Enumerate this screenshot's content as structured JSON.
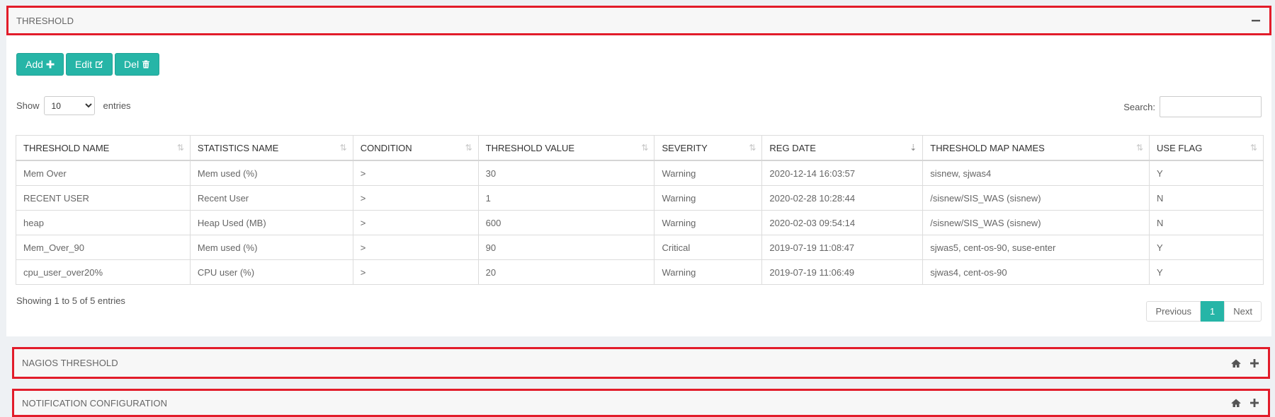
{
  "threshold_panel": {
    "title": "THRESHOLD",
    "collapse_icon": "minus-icon"
  },
  "toolbar": {
    "add_label": "Add",
    "edit_label": "Edit",
    "del_label": "Del"
  },
  "length": {
    "show_label": "Show",
    "selected": "10",
    "entries_label": "entries"
  },
  "search": {
    "label": "Search:",
    "value": ""
  },
  "table": {
    "headers": [
      "THRESHOLD NAME",
      "STATISTICS NAME",
      "CONDITION",
      "THRESHOLD VALUE",
      "SEVERITY",
      "REG DATE",
      "THRESHOLD MAP NAMES",
      "USE FLAG"
    ],
    "rows": [
      [
        "Mem Over",
        "Mem used (%)",
        ">",
        "30",
        "Warning",
        "2020-12-14 16:03:57",
        "sisnew, sjwas4",
        "Y"
      ],
      [
        "RECENT USER",
        "Recent User",
        ">",
        "1",
        "Warning",
        "2020-02-28 10:28:44",
        "/sisnew/SIS_WAS (sisnew)",
        "N"
      ],
      [
        "heap",
        "Heap Used (MB)",
        ">",
        "600",
        "Warning",
        "2020-02-03 09:54:14",
        "/sisnew/SIS_WAS (sisnew)",
        "N"
      ],
      [
        "Mem_Over_90",
        "Mem used (%)",
        ">",
        "90",
        "Critical",
        "2019-07-19 11:08:47",
        "sjwas5, cent-os-90, suse-enter",
        "Y"
      ],
      [
        "cpu_user_over20%",
        "CPU user (%)",
        ">",
        "20",
        "Warning",
        "2019-07-19 11:06:49",
        "sjwas4, cent-os-90",
        "Y"
      ]
    ]
  },
  "info": "Showing 1 to 5 of 5 entries",
  "pager": {
    "previous": "Previous",
    "current": "1",
    "next": "Next"
  },
  "nagios_panel": {
    "title": "NAGIOS THRESHOLD"
  },
  "notification_panel": {
    "title": "NOTIFICATION CONFIGURATION"
  },
  "colors": {
    "accent": "#26b5a7",
    "highlight_border": "#e21c2a"
  }
}
